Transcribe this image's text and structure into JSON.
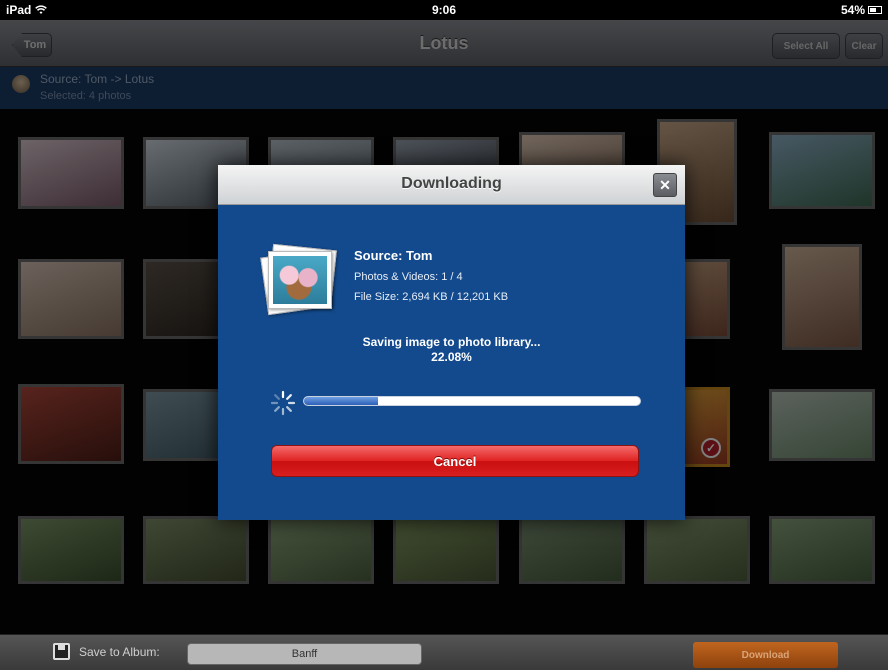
{
  "status_bar": {
    "device": "iPad",
    "time": "9:06",
    "battery": "54%"
  },
  "nav": {
    "back_label": "Tom",
    "title": "Lotus",
    "select_all_label": "Select All",
    "clear_label": "Clear"
  },
  "banner": {
    "source": "Source: Tom -> Lotus",
    "selected": "Selected: 4 photos"
  },
  "modal": {
    "title": "Downloading",
    "source": "Source: Tom",
    "photos_videos": "Photos & Videos: 1 / 4",
    "file_size": "File Size: 2,694 KB / 12,201 KB",
    "status_line": "Saving image to photo library...",
    "percent_text": "22.08%",
    "progress_fraction": 0.2208,
    "cancel_label": "Cancel"
  },
  "toolbar": {
    "save_label": "Save to Album:",
    "album_value": "Banff",
    "download_label": "Download"
  },
  "colors": {
    "modal_bg": "#134a8d",
    "cancel_red": "#e02222",
    "banner_blue": "#1b3a64",
    "download_orange": "#b0561a"
  },
  "photos": [
    {
      "selected": false
    },
    {
      "selected": false
    },
    {
      "selected": false
    },
    {
      "selected": false
    },
    {
      "selected": false
    },
    {
      "selected": false
    },
    {
      "selected": false
    },
    {
      "selected": false
    },
    {
      "selected": false
    },
    {
      "selected": false
    },
    {
      "selected": false
    },
    {
      "selected": false
    },
    {
      "selected": false
    },
    {
      "selected": false
    },
    {
      "selected": false
    },
    {
      "selected": false
    },
    {
      "selected": false
    },
    {
      "selected": false
    },
    {
      "selected": false
    },
    {
      "selected": true
    },
    {
      "selected": false
    },
    {
      "selected": false
    },
    {
      "selected": false
    },
    {
      "selected": false
    },
    {
      "selected": false
    },
    {
      "selected": false
    },
    {
      "selected": false
    },
    {
      "selected": false
    }
  ]
}
